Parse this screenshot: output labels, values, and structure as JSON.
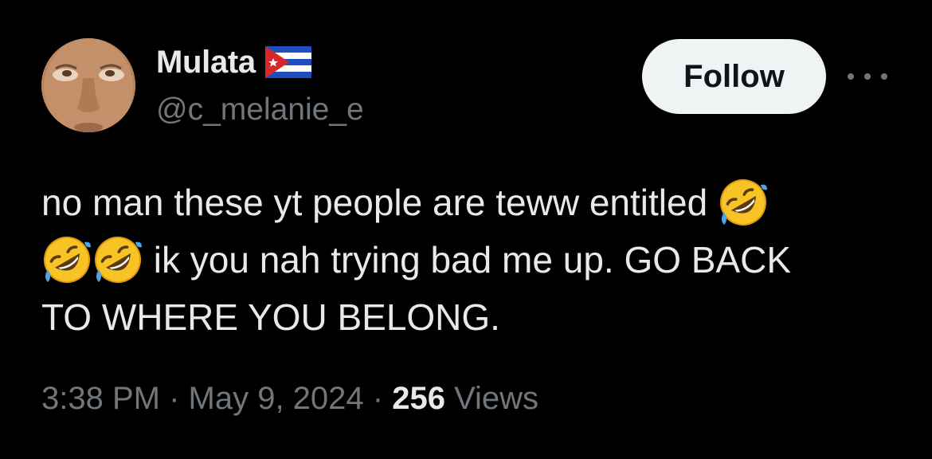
{
  "author": {
    "display_name": "Mulata",
    "handle": "@c_melanie_e",
    "flag_icon": "cuba-flag-icon",
    "avatar": "avatar-photo"
  },
  "actions": {
    "follow_label": "Follow",
    "more_icon": "more-options-icon"
  },
  "tweet": {
    "line1_text": "no man these yt people are teww entitled ",
    "line2_text": " ik you nah trying bad me up. GO BACK",
    "line3_text": "TO WHERE YOU BELONG.",
    "emoji_name": "rolling-on-the-floor-laughing-emoji"
  },
  "meta": {
    "time": "3:38 PM",
    "separator": " · ",
    "date": "May 9, 2024",
    "views_count": "256",
    "views_label": " Views"
  },
  "colors": {
    "background": "#000000",
    "primary_text": "#e7e9ea",
    "secondary_text": "#71767b",
    "follow_button_bg": "#eff3f4",
    "follow_button_text": "#0f1419"
  }
}
